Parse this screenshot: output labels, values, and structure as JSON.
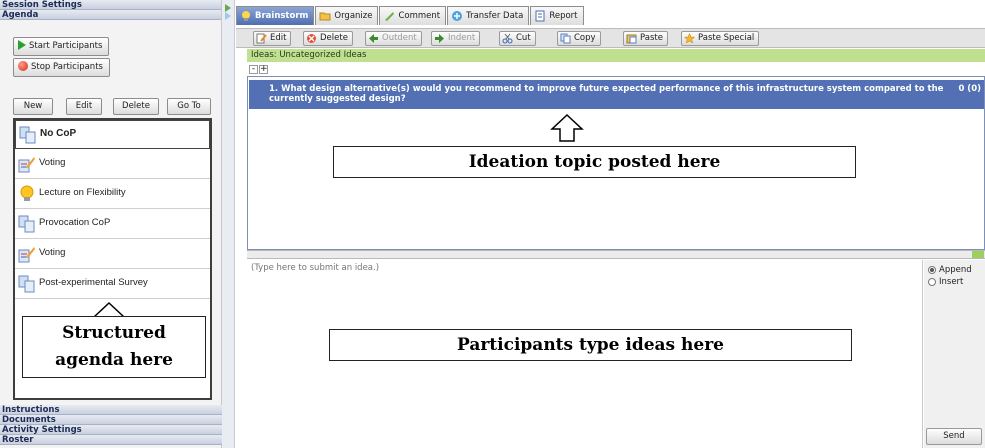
{
  "left_panel": {
    "sections_top": [
      "Session Settings",
      "Agenda"
    ],
    "controls": {
      "start_label": "Start Participants",
      "stop_label": "Stop Participants"
    },
    "agenda_toolbar": {
      "new": "New",
      "edit": "Edit",
      "delete": "Delete",
      "goto": "Go To"
    },
    "agenda_items": [
      {
        "label": "No CoP",
        "icon": "copy-doc-icon",
        "selected": true
      },
      {
        "label": "Voting",
        "icon": "voting-icon"
      },
      {
        "label": "Lecture on Flexibility",
        "icon": "lightbulb-icon"
      },
      {
        "label": "Provocation CoP",
        "icon": "copy-doc-icon"
      },
      {
        "label": "Voting",
        "icon": "voting-icon"
      },
      {
        "label": "Post-experimental Survey",
        "icon": "survey-icon"
      }
    ],
    "annotation": {
      "line1": "Structured",
      "line2": "agenda here"
    },
    "sections_bottom": [
      "Instructions",
      "Documents",
      "Activity Settings",
      "Roster"
    ]
  },
  "tabs": [
    "Brainstorm",
    "Organize",
    "Comment",
    "Transfer Data",
    "Report"
  ],
  "active_tab": "Brainstorm",
  "toolbar": {
    "edit": "Edit",
    "delete": "Delete",
    "outdent": "Outdent",
    "indent": "Indent",
    "cut": "Cut",
    "copy": "Copy",
    "paste": "Paste",
    "paste_special": "Paste Special"
  },
  "ideas_header": "Ideas: Uncategorized Ideas",
  "expand_controls": {
    "collapse": "-",
    "expand": "+"
  },
  "idea": {
    "number": "1.",
    "text": "What design alternative(s) would you recommend to improve future expected performance of this infrastructure system compared to the currently suggested design?",
    "votes": "0 (0)"
  },
  "annotation_topic": "Ideation topic posted here",
  "input": {
    "placeholder": "(Type here to submit an idea.)"
  },
  "annotation_type": "Participants type ideas here",
  "options": {
    "append": "Append",
    "insert": "Insert",
    "send": "Send"
  },
  "colors": {
    "active_tab": "#4f6eaf",
    "idea_row": "#5270b3",
    "ideas_header": "#bfe08f"
  }
}
